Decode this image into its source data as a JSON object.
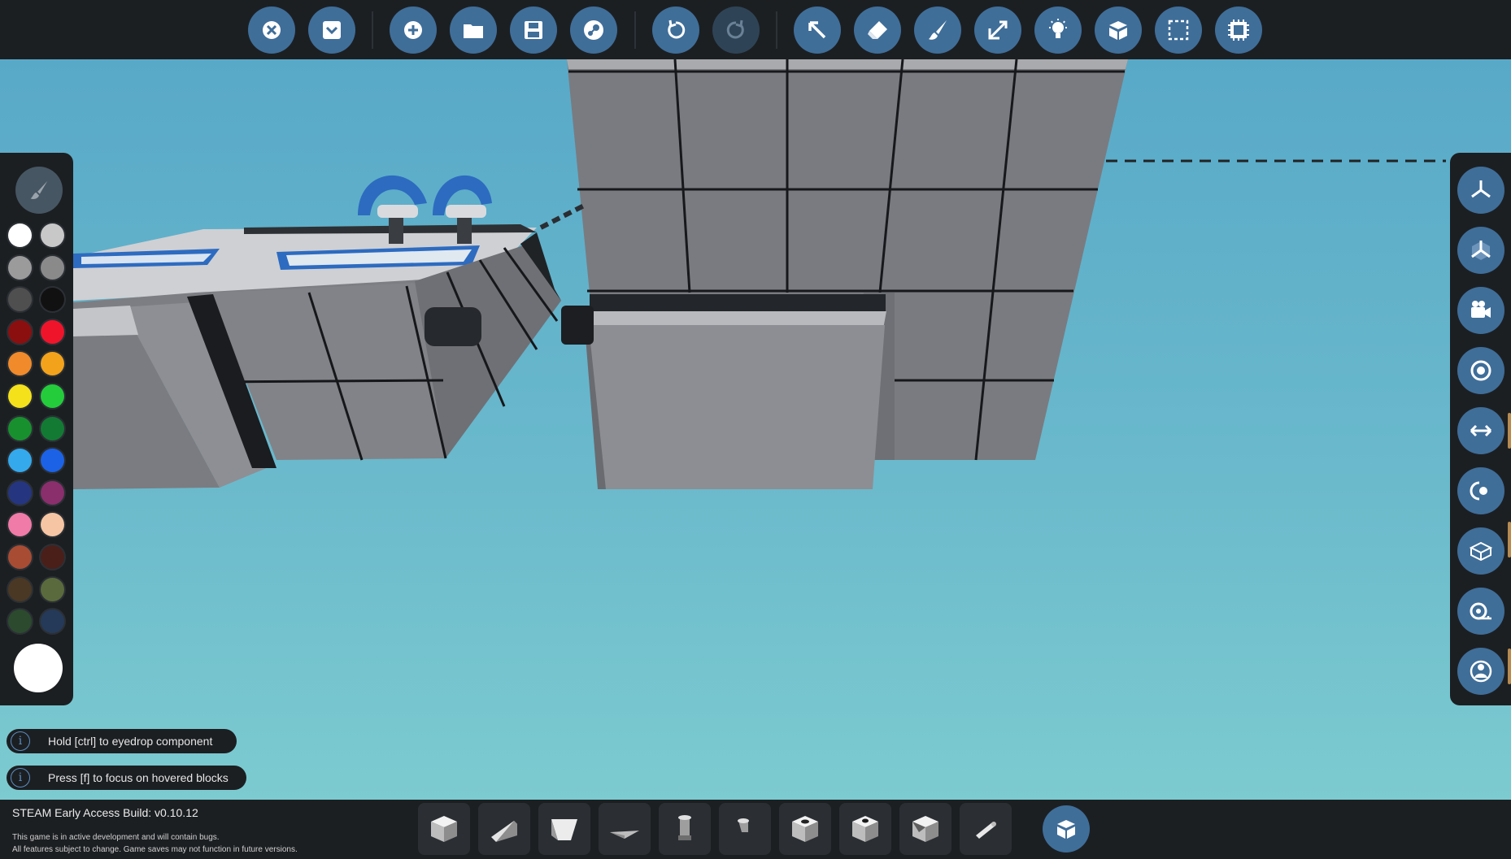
{
  "toolbar": {
    "buttons": [
      {
        "name": "close-icon"
      },
      {
        "name": "collapse-icon"
      },
      {
        "name": "new-icon"
      },
      {
        "name": "open-folder-icon"
      },
      {
        "name": "save-icon"
      },
      {
        "name": "steam-icon"
      },
      {
        "name": "undo-icon"
      },
      {
        "name": "redo-icon",
        "enabled": false
      },
      {
        "name": "select-cursor-icon"
      },
      {
        "name": "eraser-icon"
      },
      {
        "name": "paint-brush-icon"
      },
      {
        "name": "resize-icon"
      },
      {
        "name": "light-bulb-icon"
      },
      {
        "name": "parts-icon"
      },
      {
        "name": "box-select-icon"
      },
      {
        "name": "microprocessor-icon"
      }
    ]
  },
  "palette": {
    "colors": [
      "#ffffff",
      "#c8c8c8",
      "#9b9b9b",
      "#8a8a8a",
      "#4f4f4f",
      "#111111",
      "#8c0f10",
      "#f0142b",
      "#f08a2a",
      "#f3a21c",
      "#f4e11c",
      "#24cc3c",
      "#18902e",
      "#137a33",
      "#34a9ec",
      "#1b62e6",
      "#25357f",
      "#8a2e6c",
      "#f07aa8",
      "#f6c5a3",
      "#a84c33",
      "#4a1f1a",
      "#4a3824",
      "#5b6a3c",
      "#2c4a2e",
      "#253a58"
    ],
    "current_color": "#ffffff"
  },
  "right_panel": {
    "buttons": [
      {
        "name": "view-axis-icon"
      },
      {
        "name": "view-iso-icon"
      },
      {
        "name": "camera-icon"
      },
      {
        "name": "target-icon"
      },
      {
        "name": "transfer-icon"
      },
      {
        "name": "rotate-view-icon"
      },
      {
        "name": "box-outline-icon"
      },
      {
        "name": "measure-tape-icon"
      },
      {
        "name": "character-icon"
      }
    ]
  },
  "hints": [
    {
      "text": "Hold [ctrl] to eyedrop component"
    },
    {
      "text": "Press [f] to focus on hovered blocks"
    }
  ],
  "hint_icon": "i",
  "footer": {
    "build": "STEAM Early Access Build: v0.10.12",
    "disclaimer_1": "This game is in active development and will contain bugs.",
    "disclaimer_2": "All features subject to change. Game saves may not function in future versions."
  },
  "hotbar": {
    "slots": [
      {
        "name": "block-cube-icon"
      },
      {
        "name": "wedge-icon"
      },
      {
        "name": "slope-icon"
      },
      {
        "name": "flat-wedge-icon"
      },
      {
        "name": "pipe-icon"
      },
      {
        "name": "pipe-elbow-icon"
      },
      {
        "name": "button-block-icon"
      },
      {
        "name": "hole-block-icon"
      },
      {
        "name": "corner-block-icon"
      },
      {
        "name": "rod-icon"
      }
    ],
    "browser": {
      "name": "parts-browser-icon"
    }
  }
}
